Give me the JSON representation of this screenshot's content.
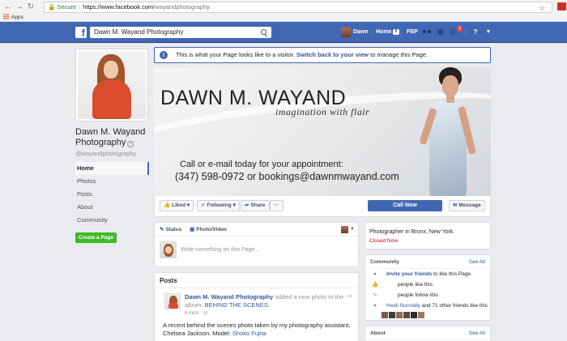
{
  "browser": {
    "secure_label": "Secure",
    "url_host": "https://www.facebook.com",
    "url_path": "/wayandphotography",
    "bookmarks_apps": "Apps",
    "icons": [
      "back-icon",
      "forward-icon",
      "reload-icon",
      "lock-icon",
      "star-icon",
      "apps-grid-icon"
    ]
  },
  "fb_topbar": {
    "search_value": "Dawn M. Wayand Photography",
    "user_name": "Dawn",
    "home_label": "Home",
    "home_count": "8",
    "page_shortcut": "FBP",
    "notifications_count": "1",
    "brand_color": "#4267b2"
  },
  "left_column": {
    "page_name": "Dawn M. Wayand Photography",
    "verified_mark": "✓",
    "handle": "@wayandphotography",
    "nav": [
      {
        "label": "Home",
        "active": true
      },
      {
        "label": "Photos",
        "active": false
      },
      {
        "label": "Posts",
        "active": false
      },
      {
        "label": "About",
        "active": false
      },
      {
        "label": "Community",
        "active": false
      }
    ],
    "create_page_label": "Create a Page"
  },
  "notice": {
    "info_glyph": "i",
    "text_before": "This is what your Page looks like to a visitor.",
    "link": "Switch back to your view",
    "text_after": "to manage this Page."
  },
  "cover": {
    "title": "DAWN M. WAYAND",
    "tagline": "imagination with flair",
    "call_line": "Call or e-mail today for your appointment:",
    "contact_line": "(347) 598-0972 or bookings@dawnmwayand.com"
  },
  "actions": {
    "liked": "Liked",
    "following": "Following",
    "share": "Share",
    "more": "···",
    "call_now": "Call Now",
    "message": "Message"
  },
  "composer": {
    "status_tab": "Status",
    "photo_tab": "Photo/Video",
    "placeholder": "Write something on this Page..."
  },
  "posts": {
    "title": "Posts",
    "author": "Dawn M. Wayand Photography",
    "action_text": "added a new photo to the album:",
    "album": "BEHIND THE SCENES.",
    "time": "6 mins",
    "more": "···",
    "body": "A recent behind the scenes photo taken by my photography assistant, Chelsea Jackson. Model:",
    "model_link": "Shoko Fujita"
  },
  "right_column": {
    "category": "Photographer in Bronx, New York",
    "status": "Closed Now",
    "community_title": "Community",
    "see_all": "See All",
    "invite_link": "Invite your friends",
    "invite_rest": "to like this Page",
    "likes_text": "people like this",
    "follows_text": "people follow this",
    "friend_name": "Heidi Nunnally",
    "friends_rest": "and 71 other friends like this",
    "about_title": "About"
  }
}
